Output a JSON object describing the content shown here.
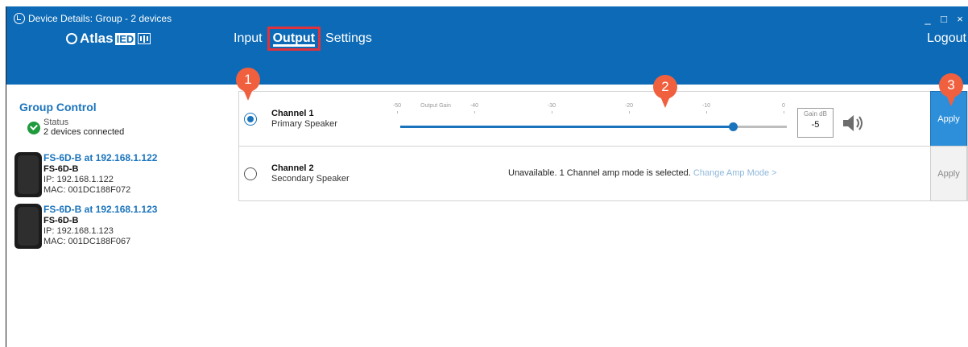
{
  "window": {
    "title": "Device Details: Group - 2 devices",
    "controls": [
      "_",
      "□",
      "×"
    ]
  },
  "header": {
    "logo": {
      "atlas": "Atlas",
      "ied": "IED"
    },
    "tabs": [
      {
        "label": "Input",
        "active": false
      },
      {
        "label": "Output",
        "active": true
      },
      {
        "label": "Settings",
        "active": false
      }
    ],
    "logout_label": "Logout"
  },
  "sidebar": {
    "title": "Group Control",
    "status_label": "Status",
    "status_text": "2 devices connected",
    "devices": [
      {
        "name": "FS-6D-B at 192.168.1.122",
        "model": "FS-6D-B",
        "ip": "IP: 192.168.1.122",
        "mac": "MAC: 001DC188F072"
      },
      {
        "name": "FS-6D-B at 192.168.1.123",
        "model": "FS-6D-B",
        "ip": "IP: 192.168.1.123",
        "mac": "MAC: 001DC188F067"
      }
    ]
  },
  "channels": [
    {
      "name": "Channel 1",
      "description": "Primary Speaker",
      "selected": true,
      "gain_title": "Output Gain",
      "scale_labels": [
        "-50",
        "-40",
        "-30",
        "-20",
        "-10",
        "0"
      ],
      "gain_label": "Gain dB",
      "gain_value": "-5",
      "gain_fraction": 0.86,
      "speaker_icon": "speaker-volume-icon",
      "apply_label": "Apply"
    },
    {
      "name": "Channel 2",
      "description": "Secondary Speaker",
      "selected": false,
      "unavailable_text": "Unavailable.  1 Channel amp mode is selected.",
      "change_link": "Change Amp Mode >",
      "apply_label": "Apply"
    }
  ],
  "annotations": [
    "1",
    "2",
    "3"
  ],
  "colors": {
    "brand": "#0c6ab6",
    "accent": "#1a74bd",
    "marker": "#f0603f",
    "highlight": "#e0323c",
    "status_ok": "#1f9a3c"
  }
}
